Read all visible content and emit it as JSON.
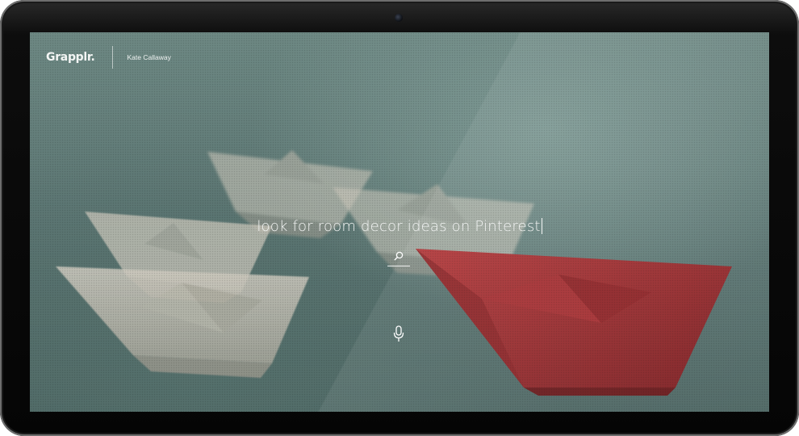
{
  "app": {
    "logo": "Grapplr.",
    "user_name": "Kate Callaway"
  },
  "search": {
    "query": "look for room decor ideas on Pinterest",
    "submit_icon": "search-icon",
    "voice_icon": "microphone-icon"
  },
  "background": {
    "description_colors": {
      "teal_backdrop": "#5d7774",
      "paper_white": "#d9d4c8",
      "paper_red": "#9c2b2d"
    }
  }
}
